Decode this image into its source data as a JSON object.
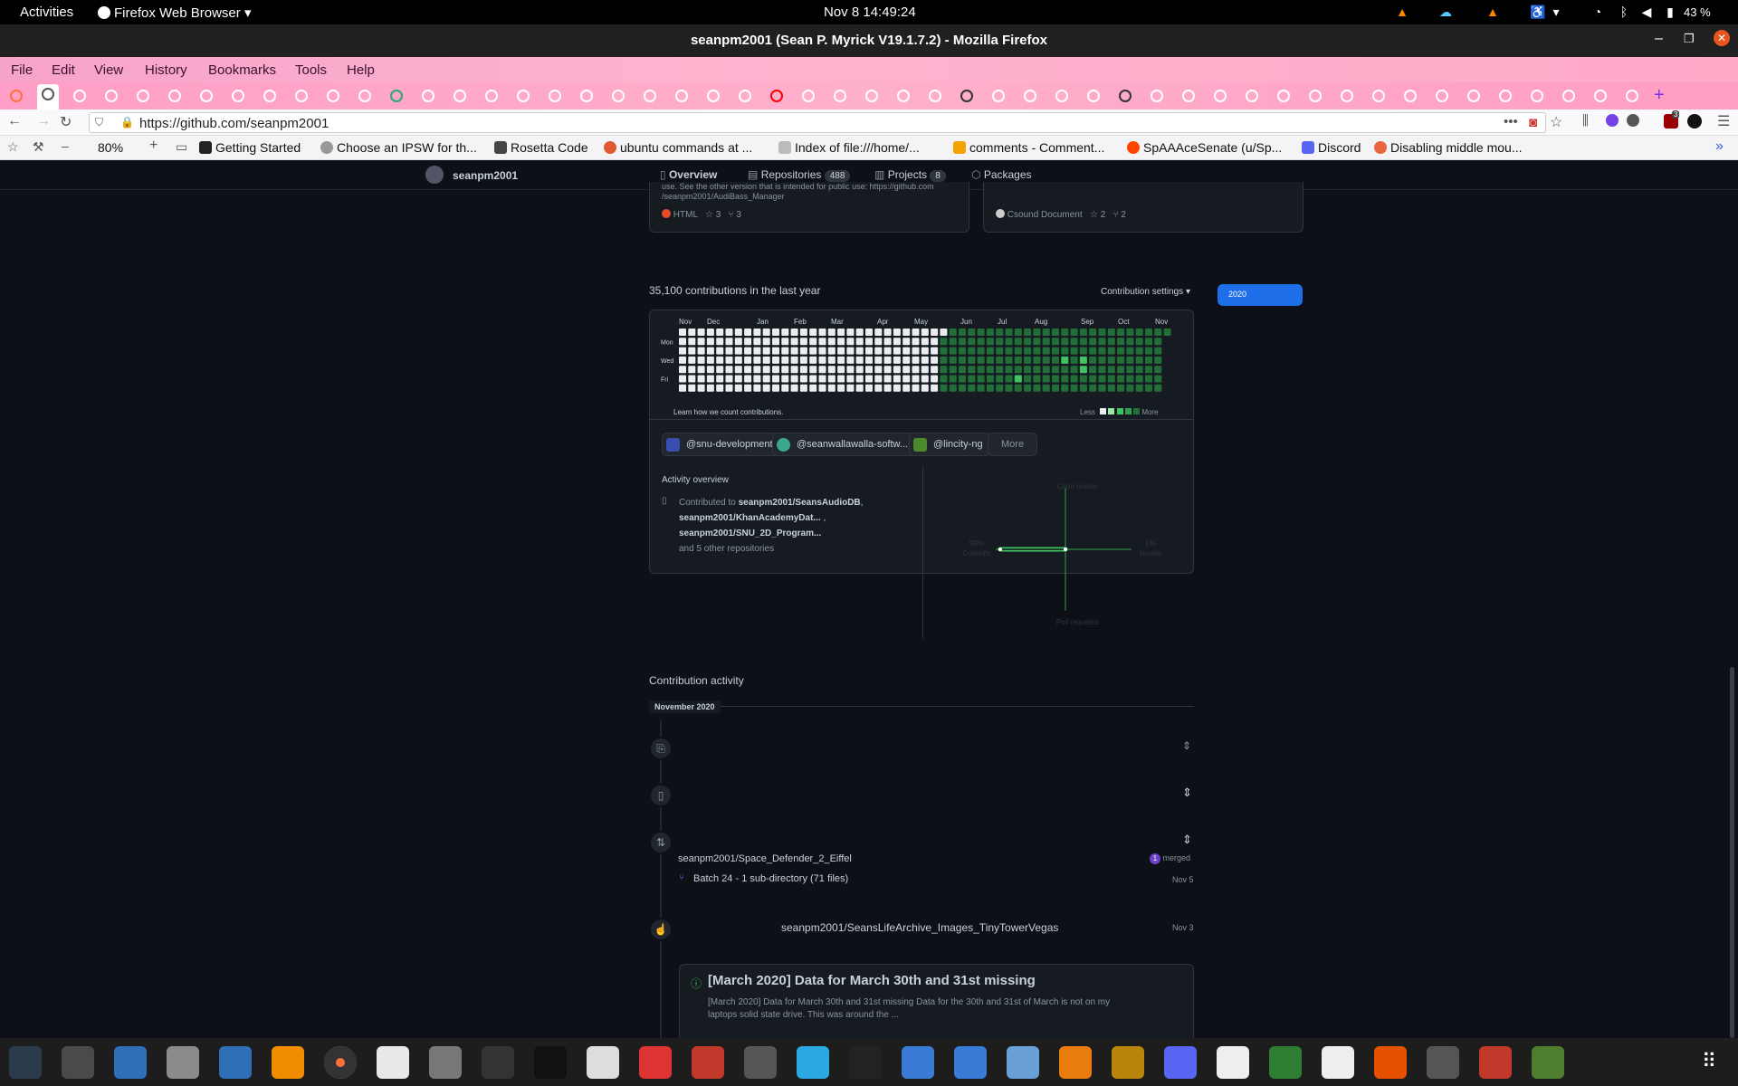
{
  "topbar": {
    "activities": "Activities",
    "app_menu": "Firefox Web Browser",
    "clock": "Nov 8  14:49:24",
    "battery": "43 %"
  },
  "window": {
    "title": "seanpm2001 (Sean P. Myrick V19.1.7.2) - Mozilla Firefox"
  },
  "menubar": [
    "File",
    "Edit",
    "View",
    "History",
    "Bookmarks",
    "Tools",
    "Help"
  ],
  "navbar": {
    "url": "https://github.com/seanpm2001",
    "zoom": "80%",
    "badge_count": "3"
  },
  "bookmarks": [
    {
      "label": "Getting Started",
      "color": "#222"
    },
    {
      "label": "Choose an IPSW for th...",
      "color": "#999"
    },
    {
      "label": "Rosetta Code",
      "color": "#444"
    },
    {
      "label": "ubuntu commands at ...",
      "color": "#de5833"
    },
    {
      "label": "Index of file:///home/...",
      "color": "#bbb"
    },
    {
      "label": "comments - Comment...",
      "color": "#f4a300"
    },
    {
      "label": "SpAAAceSenate (u/Sp...",
      "color": "#ff4500"
    },
    {
      "label": "Discord",
      "color": "#5865f2"
    },
    {
      "label": "Disabling middle mou...",
      "color": "#e8663d"
    }
  ],
  "profile_nav": {
    "username": "seanpm2001",
    "tabs": [
      {
        "label": "Overview",
        "count": ""
      },
      {
        "label": "Repositories",
        "count": "488"
      },
      {
        "label": "Projects",
        "count": "8"
      },
      {
        "label": "Packages",
        "count": ""
      }
    ]
  },
  "pinned": [
    {
      "desc1": "use. See the other version that is intended for public use: https://github.com",
      "desc2": "/seanpm2001/AudiBass_Manager",
      "lang": "HTML",
      "lang_color": "#e34c26",
      "stars": "3",
      "forks": "3"
    },
    {
      "desc1": "",
      "desc2": "",
      "lang": "Csound Document",
      "lang_color": "#cccccc",
      "stars": "2",
      "forks": "2"
    }
  ],
  "contributions": {
    "summary": "35,100 contributions in the last year",
    "settings": "Contribution settings",
    "year_button": "2020",
    "months": [
      "Nov",
      "Dec",
      "Jan",
      "Feb",
      "Mar",
      "Apr",
      "May",
      "Jun",
      "Jul",
      "Aug",
      "Sep",
      "Oct",
      "Nov"
    ],
    "days": [
      "Mon",
      "Wed",
      "Fri"
    ],
    "learn": "Learn how we count contributions.",
    "less": "Less",
    "more": "More"
  },
  "orgs": [
    {
      "label": "@snu-development",
      "color": "#3a4db0"
    },
    {
      "label": "@seanwallawalla-softw...",
      "color": "#3aa98a"
    },
    {
      "label": "@lincity-ng",
      "color": "#4b8a2a"
    }
  ],
  "orgs_more": "More",
  "activity_overview": {
    "title": "Activity overview",
    "contributed_prefix": "Contributed to",
    "repo1": "seanpm2001/SeansAudioDB",
    "repo2": "seanpm2001/KhanAcademyDat...",
    "repo3": "seanpm2001/SNU_2D_Program...",
    "others": "and 5 other repositories",
    "axis_top": "Code review",
    "axis_bottom": "Pull requests",
    "commits_pct": "99%",
    "commits_label": "Commits",
    "issues_pct": "1%",
    "issues_label": "Issues"
  },
  "activity": {
    "title": "Contribution activity",
    "month": "November 2020",
    "pr_repo": "seanpm2001/Space_Defender_2_Eiffel",
    "pr_count": "1",
    "pr_state": "merged",
    "pr_title": "Batch 24 - 1 sub-directory (71 files)",
    "pr_date": "Nov 5",
    "issue_repo": "seanpm2001/SeansLifeArchive_Images_TinyTowerVegas",
    "issue_date": "Nov 3",
    "issue_title": "[March 2020] Data for March 30th and 31st missing",
    "issue_body1": "[March 2020] Data for March 30th and 31st missing Data for the 30th and 31st of March is not on my",
    "issue_body2": "laptops solid state drive. This was around the ..."
  }
}
